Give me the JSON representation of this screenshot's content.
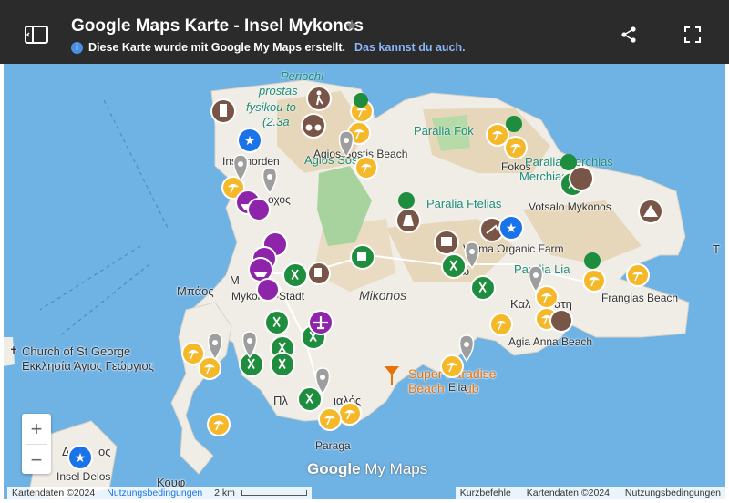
{
  "header": {
    "title": "Google Maps Karte - Insel Mykonos",
    "subtitle": "Diese Karte wurde mit Google My Maps erstellt.",
    "subtitle_link": "Das kannst du auch."
  },
  "map_labels": {
    "periochi": "Periochi",
    "prostasias": "prostas",
    "fysikou": "fysikou to",
    "area": "(2.3a",
    "agios": "Agios Sostis",
    "agios_beach": "Agios Sostis Beach",
    "inselnorden": "Inselnorden",
    "ochos": "οχος",
    "paralia_fok": "Paralia Fok",
    "fokos": "Fokos",
    "paralia_merchias": "Paralia Merchias",
    "merchias": "Merchias",
    "votsalo": "Votsalo Mykonos",
    "paralia_ftelias": "Paralia Ftelias",
    "vioma": "Vioma Organic Farm",
    "ano": "Άνω",
    "paralia_lia": "Paralia Lia",
    "kalo": "Καλ",
    "ati": "άτη",
    "frangias": "Frangias Beach",
    "mpaos": "Μπάος",
    "m_left": "Μ",
    "mykonos_stadt": "Mykonos-Stadt",
    "mykonos": "Mikonos",
    "church_en": "Church of St George",
    "church_gr": "Εκκλησία Άγιος Γεώργιος",
    "agia_anna": "Agia Anna Beach",
    "super_paradise": "Super Paradise",
    "beach": "Beach",
    "club": "ub",
    "elia": "Elia",
    "plt": "Πλ",
    "ialos": "ιαλός",
    "paraga": "Paraga",
    "delos_gr": "Δ",
    "delos_os": "ος",
    "insel_delos": "Insel Delos",
    "kouf": "Κουφ",
    "t_right": "Τ"
  },
  "zoom": {
    "plus": "+",
    "minus": "−"
  },
  "footer": {
    "kartendaten": "Kartendaten ©2024",
    "nutzung": "Nutzungsbedingungen",
    "scale": "2 km",
    "kurzbefehle": "Kurzbefehle",
    "kartendaten2": "Kartendaten ©2024",
    "nutzung2": "Nutzungsbedingungen"
  },
  "brand": {
    "google": "Google",
    "mymaps": "My Maps"
  },
  "colors": {
    "water": "#6fb2e4",
    "land": "#f0ede6",
    "terrain": "#e6d7bb",
    "park": "#a9d39e",
    "restaurant": "#1e8e3e",
    "beach": "#f5b829",
    "brown": "#795548",
    "purple": "#8e24aa",
    "blue": "#1a73e8",
    "gray": "#9e9e9e"
  },
  "icons": [
    "hiker-icon",
    "binoculars-icon",
    "lighthouse-icon",
    "star-icon",
    "beach-umbrella-icon",
    "restaurant-icon",
    "ship-icon",
    "hotel-icon",
    "coffee-icon",
    "bar-icon",
    "airplane-icon",
    "horse-icon",
    "church-icon",
    "windmill-icon",
    "tent-icon",
    "pin-icon"
  ]
}
